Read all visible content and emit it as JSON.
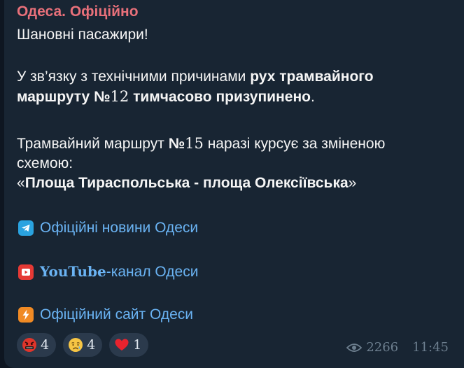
{
  "channel": {
    "name": "Одеса. Офіційно"
  },
  "message": {
    "greeting": "Шановні пасажири!",
    "p1_start": "У зв’язку з технічними причинами ",
    "p1_bold1": "рух трамвайного",
    "p1_bold2": "маршруту №",
    "p1_num": "12",
    "p1_bold3": " тимчасово призупинено",
    "p1_end": ".",
    "p2_line1_start": "Трамвайний маршрут ",
    "p2_line1_bold": "№",
    "p2_line1_num": "15",
    "p2_line1_end": " наразі курсує за зміненою",
    "p2_line2": "схемою:",
    "p2_quote_open": "«",
    "p2_quote_text": "Площа Тираспольська - площа Олексіївська",
    "p2_quote_close": "»"
  },
  "links": [
    {
      "icon": "telegram-icon",
      "label": "Офіційні новини Одеси",
      "color": "#2aa3e0"
    },
    {
      "icon": "youtube-icon",
      "label_serif": "YouTube",
      "label_rest": "-канал Одеси",
      "color": "#e53935"
    },
    {
      "icon": "lightning-icon",
      "label": "Офіційний сайт Одеси",
      "color": "#f08a24"
    }
  ],
  "reactions": [
    {
      "icon": "angry-face-icon",
      "count": "4"
    },
    {
      "icon": "crying-face-icon",
      "count": "4"
    },
    {
      "icon": "heart-icon",
      "count": "1"
    }
  ],
  "meta": {
    "views": "2266",
    "time": "11:45"
  },
  "colors": {
    "background": "#0e1621",
    "bubble": "#182533",
    "channel_name": "#e8707a",
    "link": "#6ab3f3",
    "meta": "#6d7f8f"
  }
}
